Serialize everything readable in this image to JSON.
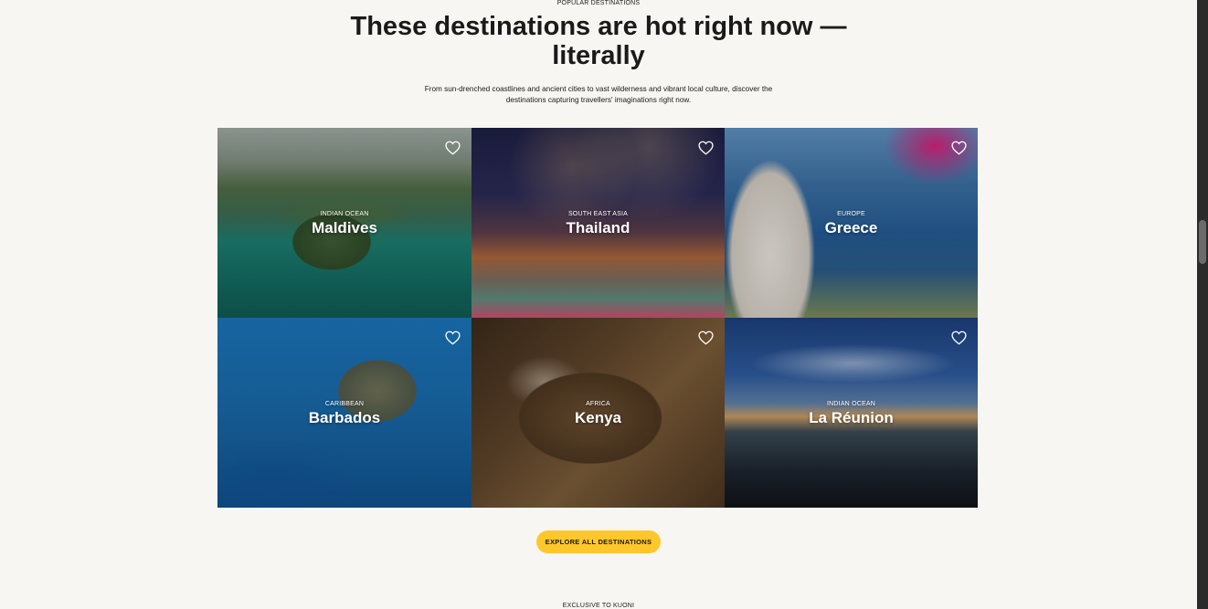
{
  "section": {
    "eyebrow": "POPULAR DESTINATIONS",
    "title": "These destinations are hot right now — literally",
    "description": "From sun-drenched coastlines and ancient cities to vast wilderness and vibrant local culture, discover the destinations capturing travellers' imaginations right now."
  },
  "destinations": [
    {
      "region": "INDIAN OCEAN",
      "name": "Maldives"
    },
    {
      "region": "SOUTH EAST ASIA",
      "name": "Thailand"
    },
    {
      "region": "EUROPE",
      "name": "Greece"
    },
    {
      "region": "CARIBBEAN",
      "name": "Barbados"
    },
    {
      "region": "AFRICA",
      "name": "Kenya"
    },
    {
      "region": "INDIAN OCEAN",
      "name": "La Réunion"
    }
  ],
  "cta": {
    "label": "EXPLORE ALL DESTINATIONS"
  },
  "next_section": {
    "eyebrow": "EXCLUSIVE TO KUONI"
  },
  "colors": {
    "background": "#f8f6f2",
    "cta": "#ffc72c",
    "text": "#1a1a1a"
  },
  "icons": {
    "favourite": "heart-outline-icon"
  }
}
